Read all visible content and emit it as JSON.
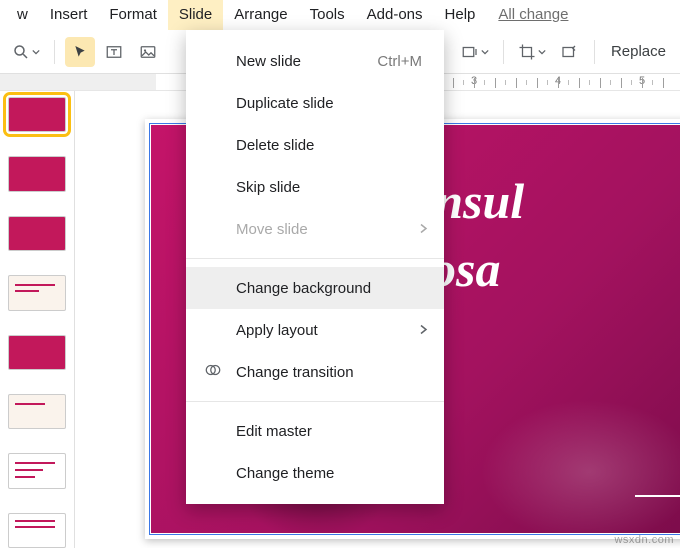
{
  "menubar": {
    "items": [
      "w",
      "Insert",
      "Format",
      "Slide",
      "Arrange",
      "Tools",
      "Add-ons",
      "Help"
    ],
    "open_index": 3,
    "status": "All change"
  },
  "toolbar": {
    "replace": "Replace"
  },
  "ruler": {
    "labels": [
      "3",
      "4",
      "5"
    ]
  },
  "dropdown": {
    "items": [
      {
        "label": "New slide",
        "shortcut": "Ctrl+M"
      },
      {
        "label": "Duplicate slide"
      },
      {
        "label": "Delete slide"
      },
      {
        "label": "Skip slide"
      },
      {
        "label": "Move slide",
        "submenu": true,
        "disabled": true
      },
      {
        "sep": true
      },
      {
        "label": "Change background",
        "hovered": true
      },
      {
        "label": "Apply layout",
        "submenu": true
      },
      {
        "label": "Change transition",
        "icon": "transition"
      },
      {
        "sep": true
      },
      {
        "label": "Edit master"
      },
      {
        "label": "Change theme"
      }
    ]
  },
  "slide": {
    "title_line1": "C Consul",
    "title_line2": "Proposa",
    "deco_x": "×"
  },
  "watermark": "wsxdn.com"
}
